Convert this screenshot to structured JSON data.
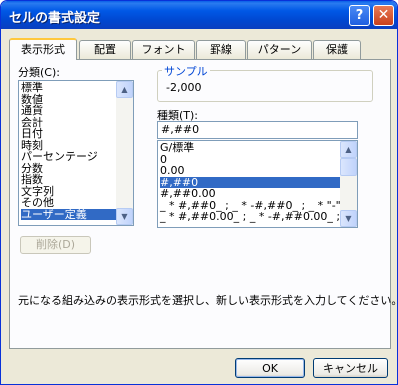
{
  "window": {
    "title": "セルの書式設定"
  },
  "titlebar_buttons": {
    "help": "?",
    "close": "✕"
  },
  "tabs": [
    {
      "label": "表示形式"
    },
    {
      "label": "配置"
    },
    {
      "label": "フォント"
    },
    {
      "label": "罫線"
    },
    {
      "label": "パターン"
    },
    {
      "label": "保護"
    }
  ],
  "category": {
    "label": "分類(C):",
    "selected": "ユーザー定義",
    "items": [
      "標準",
      "数値",
      "通貨",
      "会計",
      "日付",
      "時刻",
      "パーセンテージ",
      "分数",
      "指数",
      "文字列",
      "その他",
      "ユーザー定義"
    ]
  },
  "sample": {
    "label": "サンプル",
    "value": "-2,000"
  },
  "type": {
    "label": "種類(T):",
    "value": "#,##0",
    "selected": "#,##0",
    "items": [
      "G/標準",
      "0",
      "0.00",
      "#,##0",
      "#,##0.00",
      "_ * #,##0_ ; _ * -#,##0_ ; _ * \"-\"_ ; _ @_",
      "_ * #,##0.00_ ; _ * -#,##0.00_ ; _ * \"-\"??_ ; _ @_"
    ]
  },
  "delete_button": {
    "label": "削除(D)",
    "enabled": false
  },
  "description": "元になる組み込みの表示形式を選択し、新しい表示形式を入力してください。",
  "ok_button": {
    "label": "OK"
  },
  "cancel_button": {
    "label": "キャンセル"
  },
  "colors": {
    "titlebar": "#0058e6",
    "selection": "#316ac5",
    "active_tab_accent": "#ffc83c",
    "dialog_bg": "#ece9d8"
  }
}
